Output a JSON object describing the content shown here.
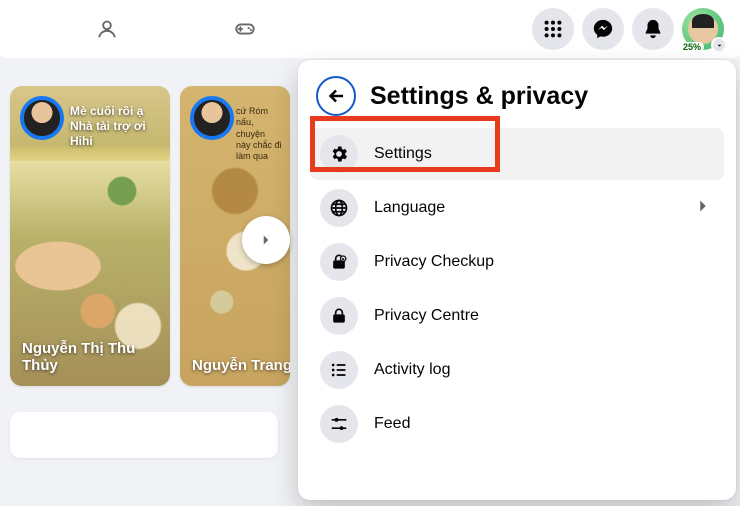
{
  "topbar": {
    "avatar_progress": "25%"
  },
  "stories": {
    "items": [
      {
        "overlay": "Mè cuối rồi ạ\nNhà tài trợ ơi\nHihi",
        "caption": "Nguyễn Thị Thu Thủy"
      },
      {
        "overlay": "cứ Róm nấu, chuyện này chắc đi làm qua",
        "caption": "Nguyễn Trang"
      }
    ]
  },
  "panel": {
    "title": "Settings & privacy",
    "items": [
      {
        "label": "Settings",
        "icon": "gear",
        "has_chevron": false
      },
      {
        "label": "Language",
        "icon": "globe",
        "has_chevron": true
      },
      {
        "label": "Privacy Checkup",
        "icon": "lock-heart",
        "has_chevron": false
      },
      {
        "label": "Privacy Centre",
        "icon": "lock",
        "has_chevron": false
      },
      {
        "label": "Activity log",
        "icon": "list",
        "has_chevron": false
      },
      {
        "label": "Feed",
        "icon": "sliders",
        "has_chevron": false
      }
    ]
  }
}
